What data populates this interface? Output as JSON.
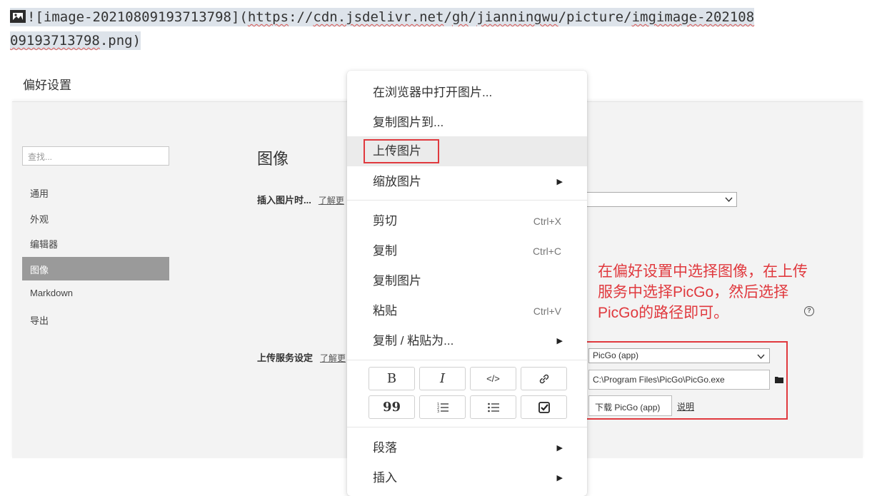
{
  "markdown": {
    "line1_prefix": "![image-20210809193713798](",
    "url_https": "https",
    "url_sep1": "://",
    "url_host": "cdn.jsdelivr.net",
    "url_sep2": "/",
    "url_gh": "gh",
    "url_sep3": "/",
    "url_user": "jianningwu",
    "url_sep4": "/picture/",
    "url_file1": "imgimage-202108",
    "url_file2": "09193713798",
    "url_ext": ".png",
    "close_paren": ")"
  },
  "preferences": {
    "title": "偏好设置",
    "search_placeholder": "查找...",
    "nav": [
      "通用",
      "外观",
      "编辑器",
      "图像",
      "Markdown",
      "导出"
    ],
    "active_nav": "图像",
    "section_heading": "图像",
    "insert_label": "插入图片时...",
    "insert_learn_more": "了解更",
    "upload_label": "上传服务设定",
    "upload_learn_more": "了解更",
    "picgo_select_value": "PicGo (app)",
    "picgo_path": "C:\\Program Files\\PicGo\\PicGo.exe",
    "download_button": "下载 PicGo (app)",
    "explain_link": "说明"
  },
  "annotation": {
    "line1": "在偏好设置中选择图像，在上传",
    "line2": "服务中选择PicGo，然后选择",
    "line3": "PicGo的路径即可。",
    "color": "#e0393e"
  },
  "context_menu": {
    "open_in_browser": "在浏览器中打开图片...",
    "copy_image_to": "复制图片到...",
    "upload_image": "上传图片",
    "zoom_image": "缩放图片",
    "cut": "剪切",
    "cut_shortcut": "Ctrl+X",
    "copy": "复制",
    "copy_shortcut": "Ctrl+C",
    "copy_image": "复制图片",
    "paste": "粘贴",
    "paste_shortcut": "Ctrl+V",
    "copy_paste_as": "复制 / 粘贴为...",
    "paragraph": "段落",
    "insert": "插入",
    "format_buttons": {
      "bold": "B",
      "italic": "I",
      "code": "</>",
      "quote": "99"
    }
  }
}
